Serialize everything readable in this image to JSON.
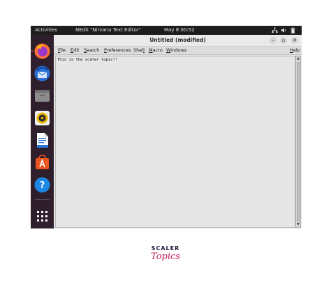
{
  "topbar": {
    "activities": "Activities",
    "app_menu": "NEdit \"Nirvana Text Editor\"",
    "clock": "May 8  00:52",
    "icons": [
      "network-icon",
      "volume-icon",
      "battery-icon"
    ]
  },
  "dock": {
    "apps": [
      {
        "name": "firefox-icon",
        "color": "#ff7139"
      },
      {
        "name": "thunderbird-icon",
        "color": "#2a6fd6"
      },
      {
        "name": "files-icon",
        "color": "#8c8c8c"
      },
      {
        "name": "rhythmbox-icon",
        "color": "#e8b400"
      },
      {
        "name": "libreoffice-writer-icon",
        "color": "#2b78d6"
      },
      {
        "name": "software-center-icon",
        "color": "#e95420"
      },
      {
        "name": "help-icon",
        "color": "#1e88e5"
      },
      {
        "name": "show-apps-icon",
        "color": "#ffffff"
      }
    ]
  },
  "window": {
    "title": "Untitled (modified)",
    "controls": {
      "minimize": "–",
      "maximize": "▫",
      "close": "✕"
    },
    "menus": [
      {
        "mnemonic": "F",
        "rest": "ile"
      },
      {
        "mnemonic": "E",
        "rest": "dit"
      },
      {
        "mnemonic": "S",
        "rest": "earch"
      },
      {
        "mnemonic": "P",
        "rest": "references"
      },
      {
        "pre": "Shel",
        "mnemonic": "l",
        "rest": ""
      },
      {
        "mnemonic": "M",
        "rest": "acro"
      },
      {
        "mnemonic": "W",
        "rest": "indows"
      },
      {
        "mnemonic": "H",
        "rest": "elp"
      }
    ],
    "editor_text": "This is the scaler topic!!"
  },
  "logo": {
    "line1": "SCALER",
    "line2": "Topics"
  },
  "colors": {
    "accent": "#e95420",
    "dock_bg": "#2f1f2c",
    "topbar_bg": "#1d1d1d",
    "logo_pink": "#c2185b",
    "logo_navy": "#1f1a3d"
  }
}
